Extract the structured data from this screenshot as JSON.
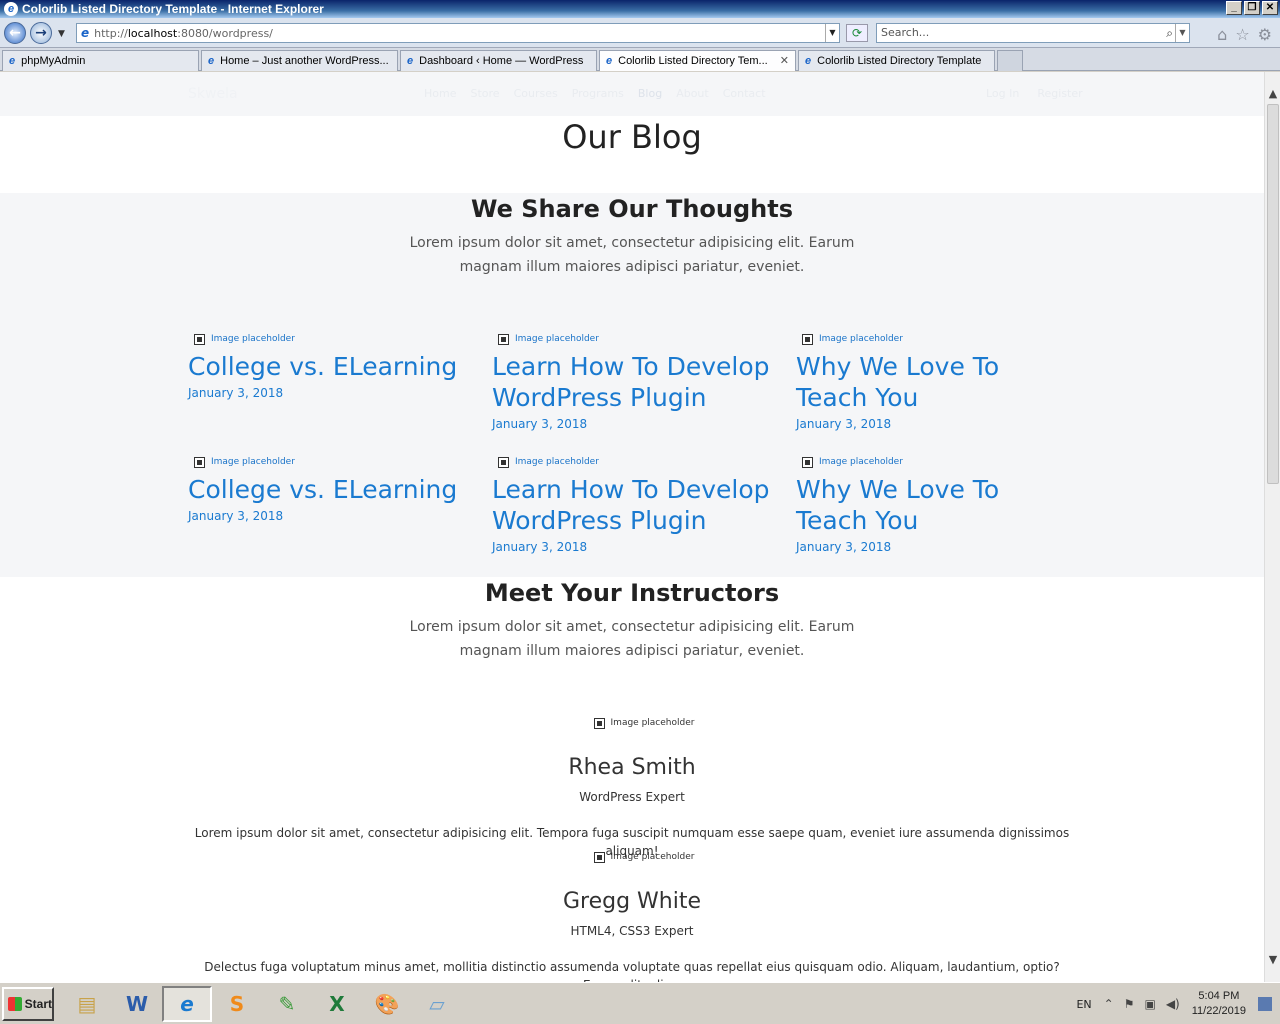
{
  "window": {
    "title": "Colorlib Listed Directory Template - Internet Explorer",
    "buttons": {
      "minimize": "_",
      "restore": "❐",
      "close": "✕"
    }
  },
  "addressbar": {
    "url_prefix": "http://",
    "url_host": "localhost",
    "url_rest": ":8080/wordpress/",
    "search_placeholder": "Search..."
  },
  "tabs": [
    {
      "label": "phpMyAdmin"
    },
    {
      "label": "Home – Just another WordPress..."
    },
    {
      "label": "Dashboard ‹ Home — WordPress"
    },
    {
      "label": "Colorlib Listed Directory Tem...",
      "active": true
    },
    {
      "label": "Colorlib Listed Directory Template"
    }
  ],
  "site": {
    "brand": "Skwela",
    "menu": [
      "Home",
      "Store",
      "Courses",
      "Programs",
      "Blog",
      "About",
      "Contact"
    ],
    "auth": [
      "Log In",
      "Register"
    ]
  },
  "page": {
    "title": "Our Blog"
  },
  "blog": {
    "heading": "We Share Our Thoughts",
    "subtext": "Lorem ipsum dolor sit amet, consectetur adipisicing elit. Earum magnam illum maiores adipisci pariatur, eveniet.",
    "image_placeholder": "Image placeholder",
    "posts": [
      {
        "title": "College vs. ELearning",
        "date": "January 3, 2018"
      },
      {
        "title": "Learn How To Develop WordPress Plugin",
        "date": "January 3, 2018"
      },
      {
        "title": "Why We Love To Teach You",
        "date": "January 3, 2018"
      },
      {
        "title": "College vs. ELearning",
        "date": "January 3, 2018"
      },
      {
        "title": "Learn How To Develop WordPress Plugin",
        "date": "January 3, 2018"
      },
      {
        "title": "Why We Love To Teach You",
        "date": "January 3, 2018"
      }
    ]
  },
  "instructors": {
    "heading": "Meet Your Instructors",
    "subtext": "Lorem ipsum dolor sit amet, consectetur adipisicing elit. Earum magnam illum maiores adipisci pariatur, eveniet.",
    "image_placeholder": "Image placeholder",
    "people": [
      {
        "name": "Rhea Smith",
        "role": "WordPress Expert",
        "bio": "Lorem ipsum dolor sit amet, consectetur adipisicing elit. Tempora fuga suscipit numquam esse saepe quam, eveniet iure assumenda dignissimos aliquam!"
      },
      {
        "name": "Gregg White",
        "role": "HTML4, CSS3 Expert",
        "bio": "Delectus fuga voluptatum minus amet, mollitia distinctio assumenda voluptate quas repellat eius quisquam odio. Aliquam, laudantium, optio? Error velit, alias."
      }
    ]
  },
  "taskbar": {
    "start_label": "Start",
    "language": "EN",
    "time": "5:04 PM",
    "date": "11/22/2019",
    "quicklaunch": [
      "file-explorer",
      "word",
      "internet-explorer",
      "sublime-text",
      "notepad-plus",
      "excel",
      "paint",
      "notepad"
    ]
  },
  "colors": {
    "link_blue": "#1a7ad0",
    "section_bg": "#f5f6f8",
    "heading": "#222222"
  }
}
